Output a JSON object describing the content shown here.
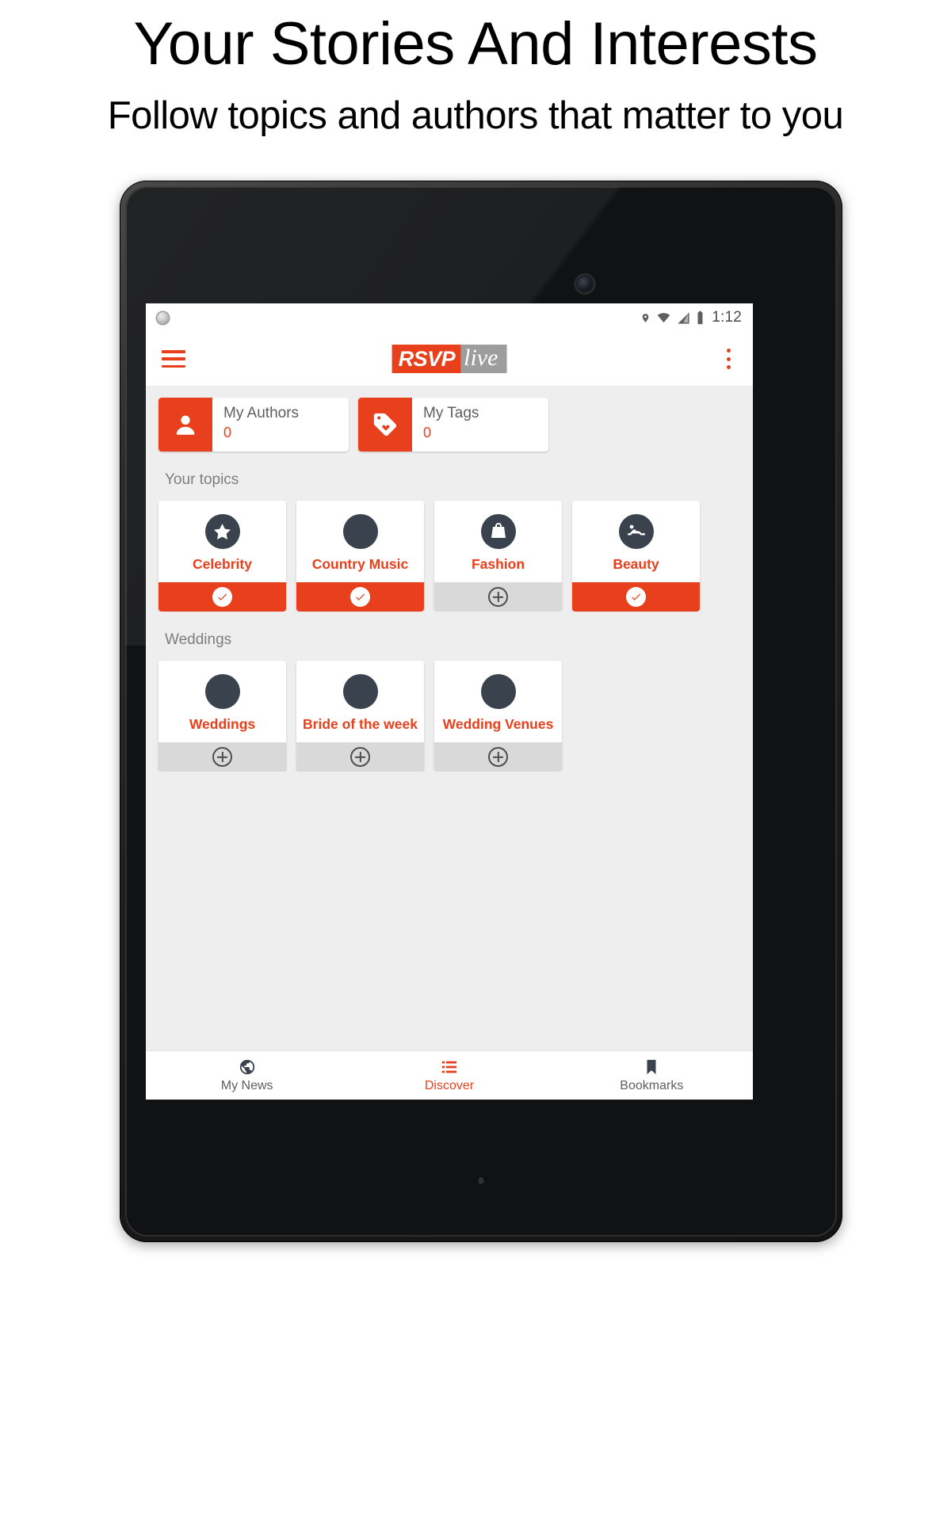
{
  "promo": {
    "title": "Your Stories And Interests",
    "subtitle": "Follow topics and authors that matter to you"
  },
  "statusbar": {
    "time": "1:12",
    "icons": [
      "location-pin-icon",
      "wifi-icon",
      "cellular-signal-icon",
      "battery-icon"
    ]
  },
  "appbar": {
    "menu_icon": "hamburger-menu-icon",
    "logo_primary": "RSVP",
    "logo_secondary": "live",
    "overflow_icon": "overflow-menu-icon"
  },
  "shortcuts": [
    {
      "label": "My Authors",
      "count": "0",
      "icon": "person-icon"
    },
    {
      "label": "My Tags",
      "count": "0",
      "icon": "tag-heart-icon"
    }
  ],
  "sections": [
    {
      "title": "Your topics",
      "cards": [
        {
          "name": "Celebrity",
          "icon": "star-icon",
          "followed": true,
          "action_label": "followed"
        },
        {
          "name": "Country Music",
          "icon": "blank-avatar-icon",
          "followed": true,
          "action_label": "followed"
        },
        {
          "name": "Fashion",
          "icon": "shopping-bag-icon",
          "followed": false,
          "action_label": "follow"
        },
        {
          "name": "Beauty",
          "icon": "spa-massage-icon",
          "followed": true,
          "action_label": "followed"
        }
      ]
    },
    {
      "title": "Weddings",
      "cards": [
        {
          "name": "Weddings",
          "icon": "blank-avatar-icon",
          "followed": false,
          "action_label": "follow"
        },
        {
          "name": "Bride of the week",
          "icon": "blank-avatar-icon",
          "followed": false,
          "action_label": "follow"
        },
        {
          "name": "Wedding Venues",
          "icon": "blank-avatar-icon",
          "followed": false,
          "action_label": "follow"
        }
      ]
    }
  ],
  "bottom_tabs": [
    {
      "label": "My News",
      "icon": "globe-icon",
      "active": false
    },
    {
      "label": "Discover",
      "icon": "list-icon",
      "active": true
    },
    {
      "label": "Bookmarks",
      "icon": "bookmark-icon",
      "active": false
    }
  ],
  "system_nav": {
    "back": "back-triangle-icon",
    "home": "home-circle-icon",
    "recents": "recents-square-icon"
  },
  "colors": {
    "accent": "#e8401c",
    "avatar": "#3a434d",
    "content_bg": "#eeeeee",
    "unfollow_bar": "#d9d9d9"
  }
}
